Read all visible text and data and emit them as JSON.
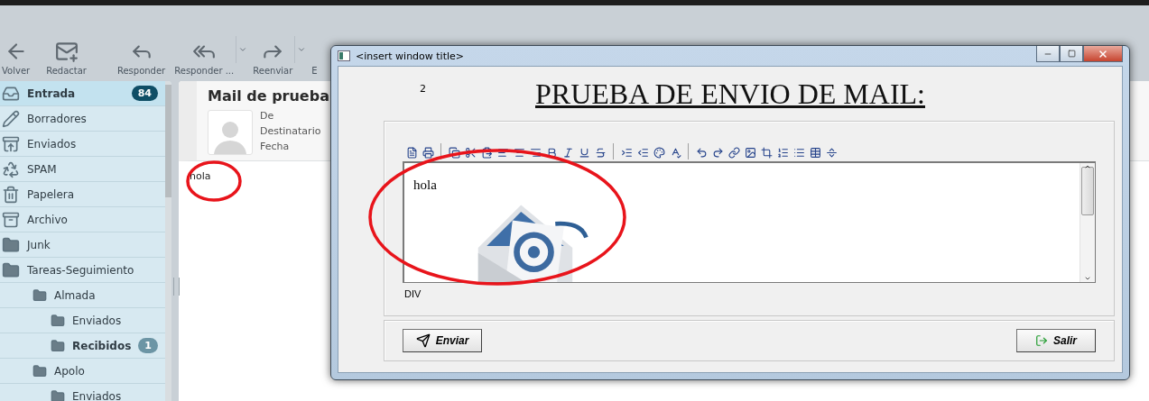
{
  "toolbar": {
    "buttons": [
      {
        "kind": "back",
        "label": "Volver",
        "dropdown": false
      },
      {
        "kind": "compose",
        "label": "Redactar",
        "dropdown": false
      },
      {
        "kind": "reply",
        "label": "Responder",
        "dropdown": false
      },
      {
        "kind": "reply_all",
        "label": "Responder ...",
        "dropdown": true
      },
      {
        "kind": "forward",
        "label": "Reenviar",
        "dropdown": true
      },
      {
        "kind": "more",
        "label": "E",
        "dropdown": false
      }
    ]
  },
  "sidebar": {
    "items": [
      {
        "kind": "inbox",
        "label": "Entrada",
        "selected": true,
        "unread": true,
        "badge": "84"
      },
      {
        "kind": "drafts",
        "label": "Borradores",
        "selected": false,
        "unread": false
      },
      {
        "kind": "sent",
        "label": "Enviados",
        "selected": false,
        "unread": false
      },
      {
        "kind": "spam",
        "label": "SPAM",
        "selected": false,
        "unread": false
      },
      {
        "kind": "trash",
        "label": "Papelera",
        "selected": false,
        "unread": false
      },
      {
        "kind": "archive",
        "label": "Archivo",
        "selected": false,
        "unread": false
      },
      {
        "kind": "folder",
        "label": "Junk",
        "selected": false,
        "unread": false
      },
      {
        "kind": "folder",
        "label": "Tareas-Seguimiento",
        "selected": false,
        "unread": false,
        "children": [
          {
            "kind": "folder",
            "label": "Almada",
            "selected": false,
            "unread": false,
            "children": [
              {
                "kind": "folder",
                "label": "Enviados",
                "selected": false,
                "unread": false
              },
              {
                "kind": "folder",
                "label": "Recibidos",
                "selected": false,
                "unread": true,
                "badge": "1"
              }
            ]
          },
          {
            "kind": "folder",
            "label": "Apolo",
            "selected": false,
            "unread": false,
            "children": [
              {
                "kind": "folder",
                "label": "Enviados",
                "selected": false,
                "unread": false
              }
            ]
          }
        ]
      }
    ]
  },
  "message": {
    "subject": "Mail de prueba",
    "fields": [
      "De",
      "Destinatario",
      "Fecha"
    ],
    "body": "hola"
  },
  "dialog": {
    "title": "<insert window title>",
    "number": "2",
    "heading": "PRUEBA DE ENVIO DE MAIL:",
    "editor": {
      "text": "hola",
      "status": "DIV"
    },
    "buttons": [
      {
        "kind": "send",
        "label": "Enviar"
      },
      {
        "kind": "exit",
        "label": "Salir"
      }
    ]
  }
}
